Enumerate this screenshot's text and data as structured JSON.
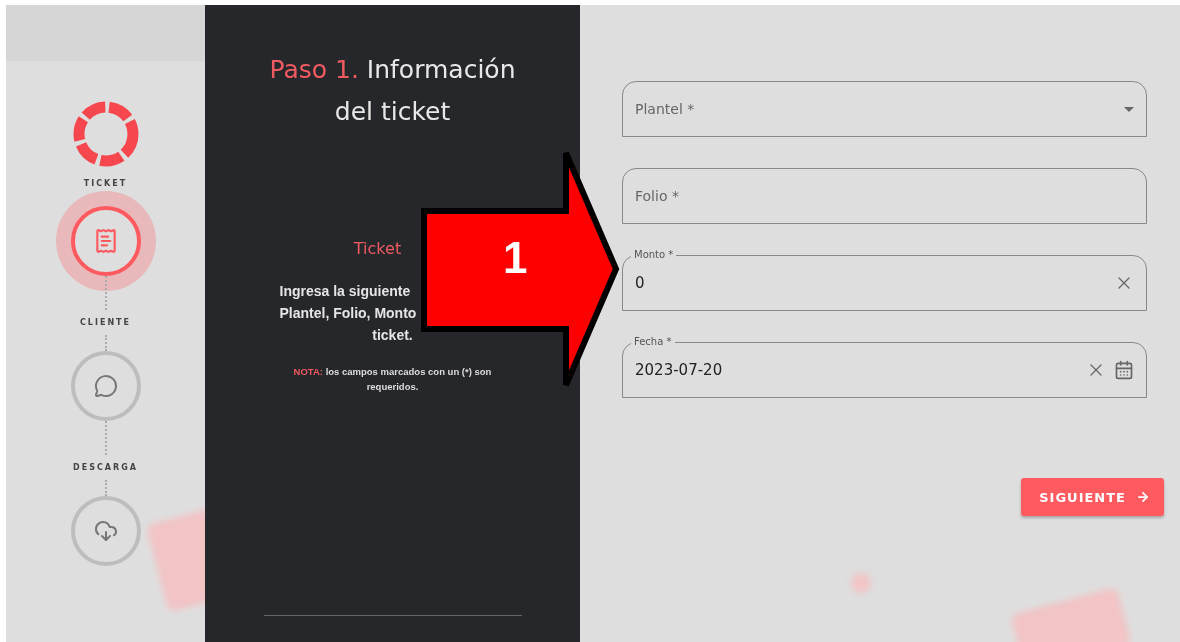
{
  "sidebar": {
    "steps": [
      {
        "label": "TICKET",
        "kind": "receipt",
        "selected": true
      },
      {
        "label": "CLIENTE",
        "kind": "chat",
        "selected": false
      },
      {
        "label": "DESCARGA",
        "kind": "download",
        "selected": false
      }
    ]
  },
  "panel": {
    "title_prefix": "Paso 1.",
    "title_line1": "Información",
    "title_line2": "del ticket",
    "subtitle": "Ticket",
    "description_lines": [
      "Ingresa la siguiente",
      "Plantel, Folio, Monto",
      "ticket."
    ],
    "note_label": "NOTA:",
    "note": "los campos marcados con un (*) son requeridos."
  },
  "annotation": {
    "label": "1"
  },
  "fields": [
    {
      "kind": "select",
      "placeholder": "Plantel *"
    },
    {
      "kind": "text",
      "placeholder": "Folio *"
    },
    {
      "kind": "text",
      "label": "Monto *",
      "value": "0"
    },
    {
      "kind": "date",
      "label": "Fecha *",
      "value": "2023-07-20"
    }
  ],
  "next_button": {
    "label": "SIGUIENTE"
  }
}
